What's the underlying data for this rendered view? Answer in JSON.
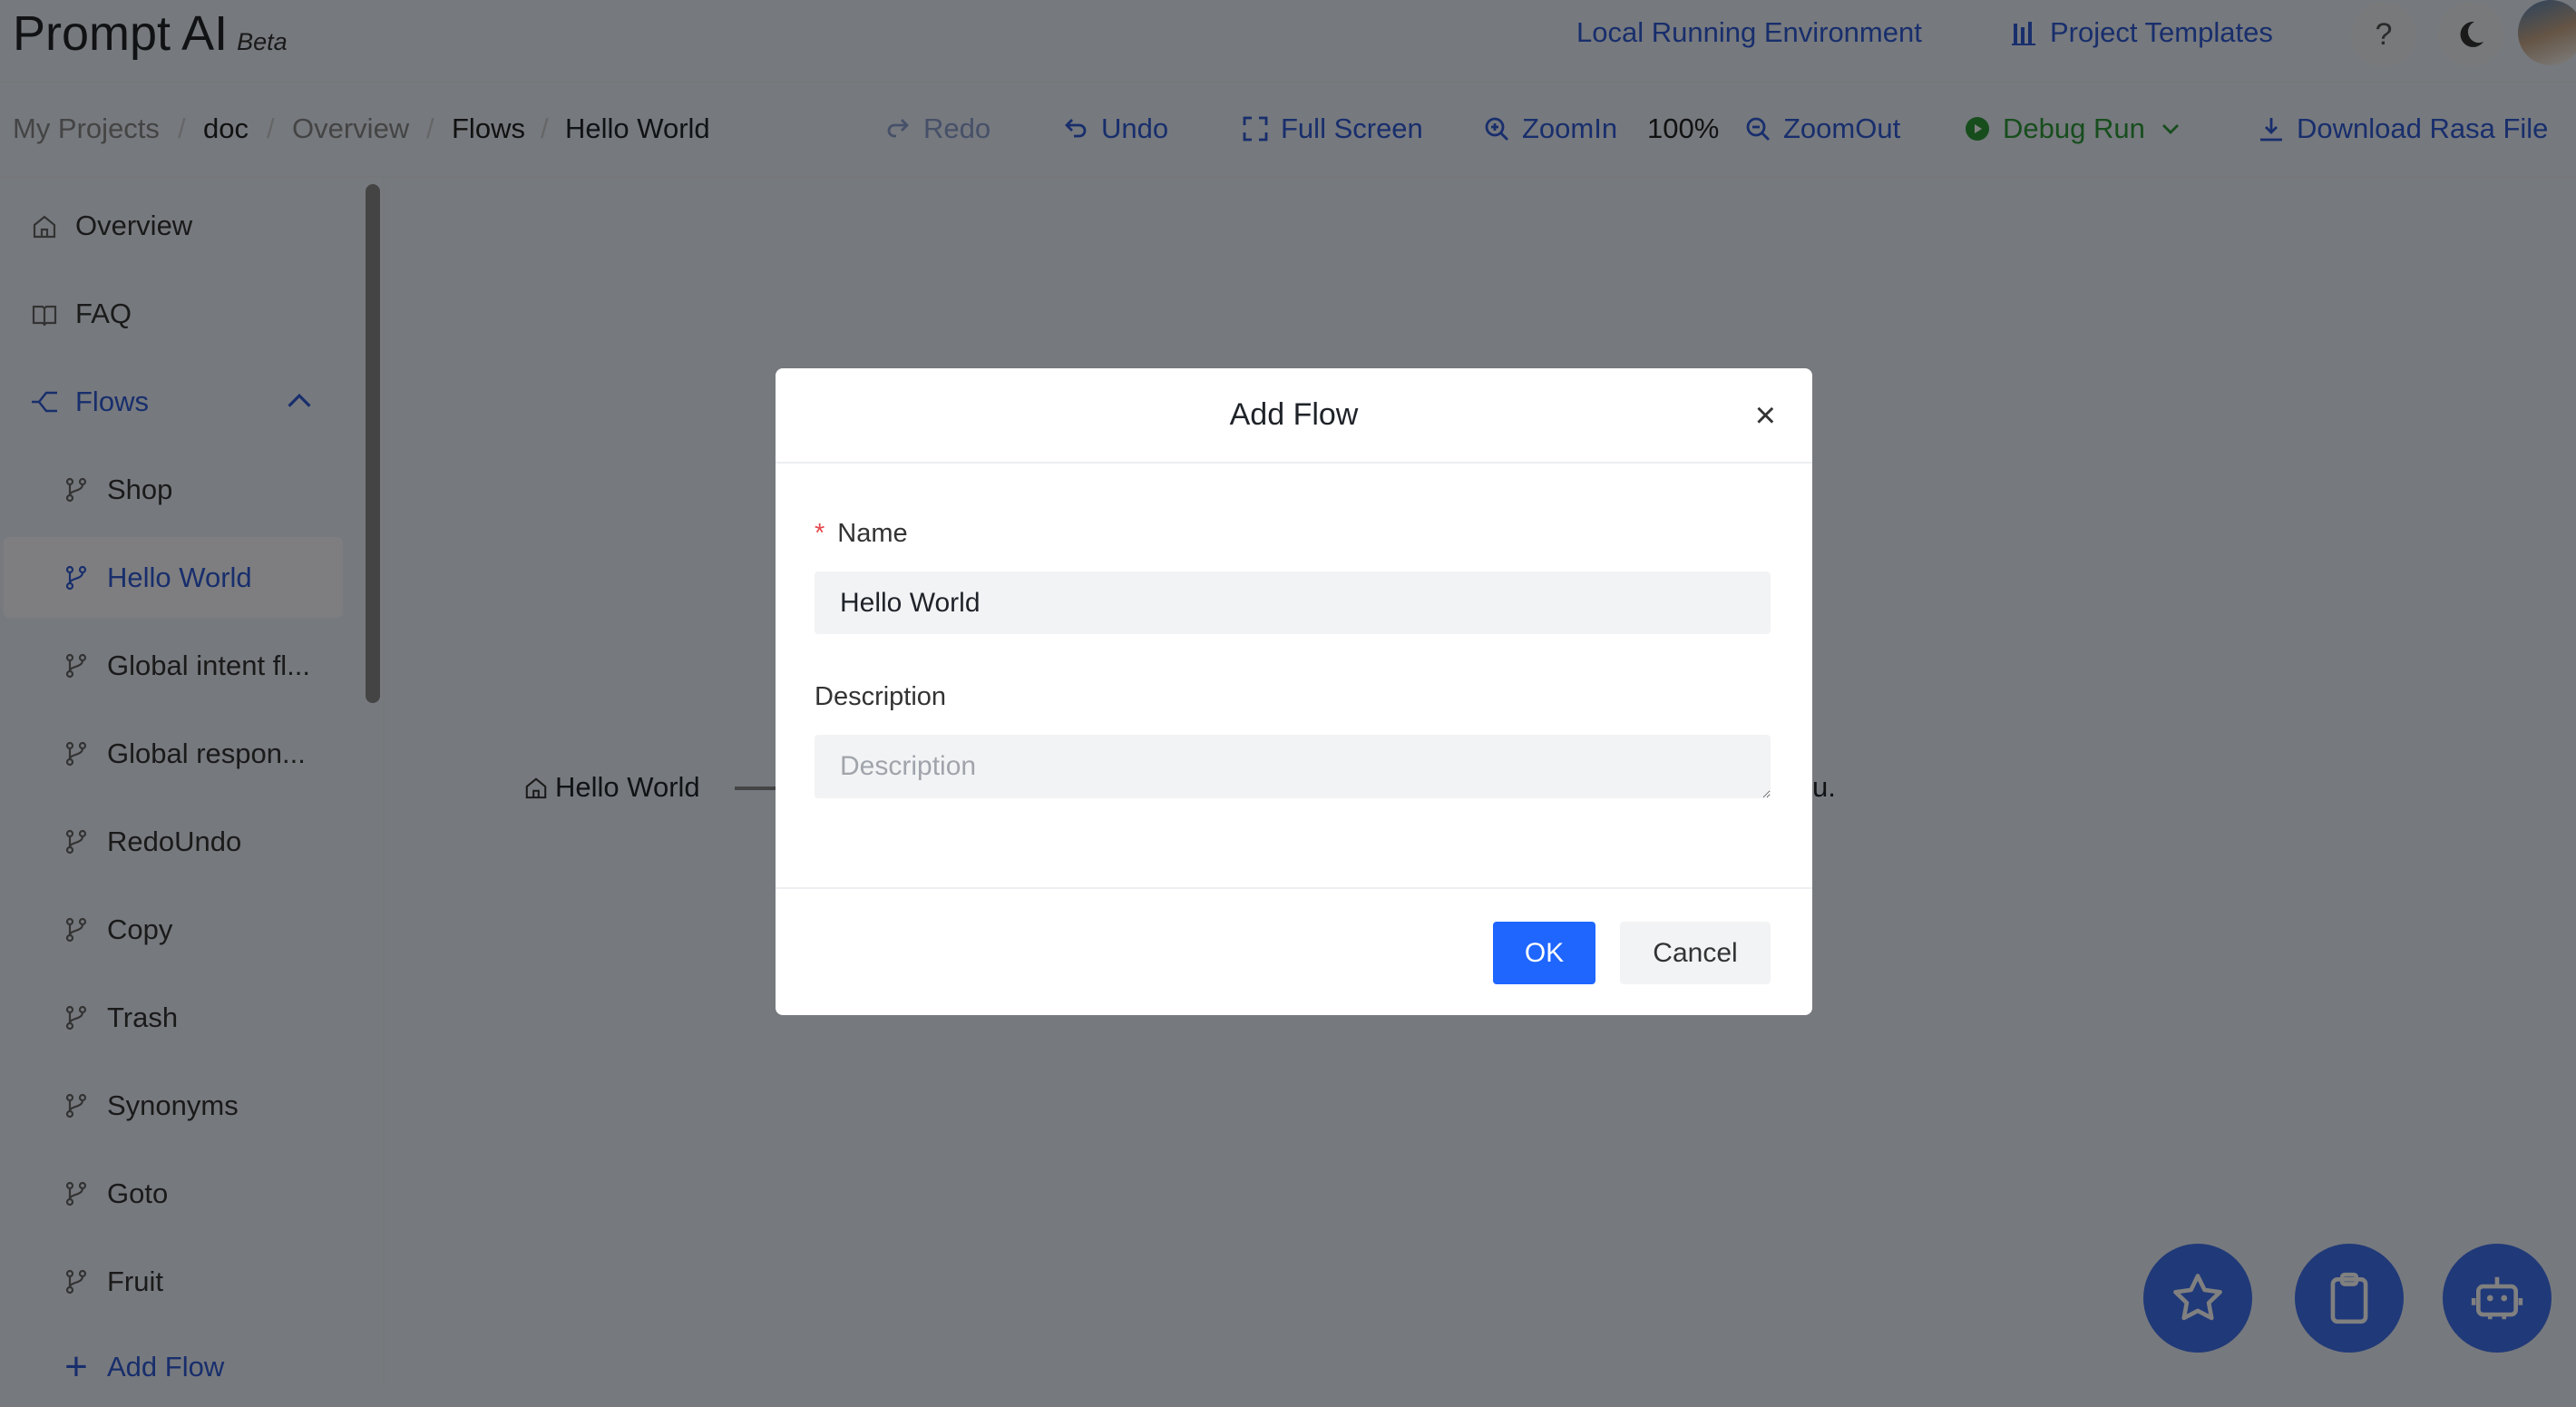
{
  "header": {
    "logo": "Prompt AI",
    "beta": "Beta",
    "local_env": "Local Running Environment",
    "templates": "Project Templates",
    "help": "?"
  },
  "breadcrumb": [
    "My Projects",
    "doc",
    "Overview",
    "Flows",
    "Hello World"
  ],
  "toolbar": {
    "redo": "Redo",
    "undo": "Undo",
    "fullscreen": "Full Screen",
    "zoomin": "ZoomIn",
    "zoom_level": "100%",
    "zoomout": "ZoomOut",
    "debug": "Debug Run",
    "download": "Download Rasa File"
  },
  "sidebar": {
    "overview": "Overview",
    "faq": "FAQ",
    "flows": "Flows",
    "flows_children": [
      "Shop",
      "Hello World",
      "Global intent fl...",
      "Global respon...",
      "RedoUndo",
      "Copy",
      "Trash",
      "Synonyms",
      "Goto",
      "Fruit"
    ],
    "selected": "Hello World",
    "add_flow": "Add Flow"
  },
  "canvas": {
    "node": "Hello World",
    "trailing": "u."
  },
  "modal": {
    "title": "Add Flow",
    "name_label": "Name",
    "name_value": "Hello World",
    "desc_label": "Description",
    "desc_placeholder": "Description",
    "ok": "OK",
    "cancel": "Cancel"
  },
  "colors": {
    "accent": "#2f5bd8",
    "primary_button": "#1f66ff",
    "debug": "#2e9a3a",
    "required": "#e5484d"
  }
}
